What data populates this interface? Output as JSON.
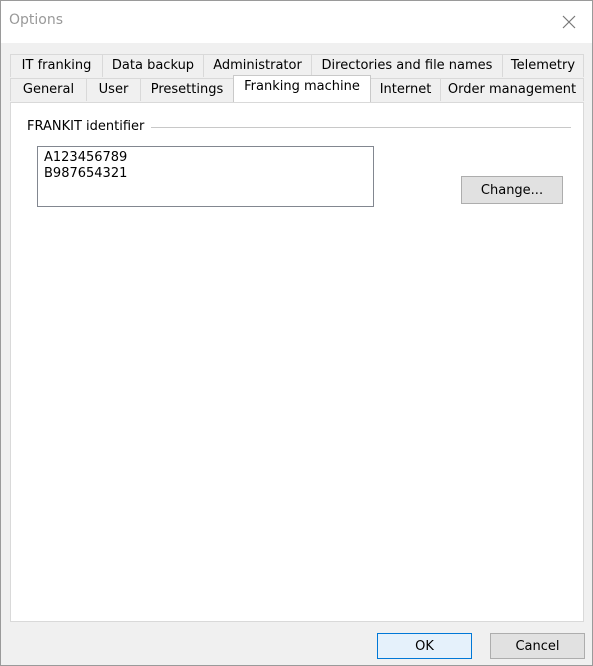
{
  "window": {
    "title": "Options"
  },
  "tabs_row1": [
    {
      "label": "IT franking"
    },
    {
      "label": "Data backup"
    },
    {
      "label": "Administrator"
    },
    {
      "label": "Directories and file names"
    },
    {
      "label": "Telemetry"
    }
  ],
  "tabs_row2": [
    {
      "label": "General"
    },
    {
      "label": "User"
    },
    {
      "label": "Presettings"
    },
    {
      "label": "Franking machine",
      "active": true
    },
    {
      "label": "Internet"
    },
    {
      "label": "Order management"
    }
  ],
  "frankit": {
    "group_label": "FRANKIT identifier",
    "identifiers": [
      "A123456789",
      "B987654321"
    ],
    "change_label": "Change..."
  },
  "footer": {
    "ok_label": "OK",
    "cancel_label": "Cancel"
  },
  "icons": {
    "close": "close-icon"
  },
  "colors": {
    "ok_border": "#0078d7",
    "panel_bg": "#ffffff",
    "dialog_bg": "#f0f0f0"
  }
}
